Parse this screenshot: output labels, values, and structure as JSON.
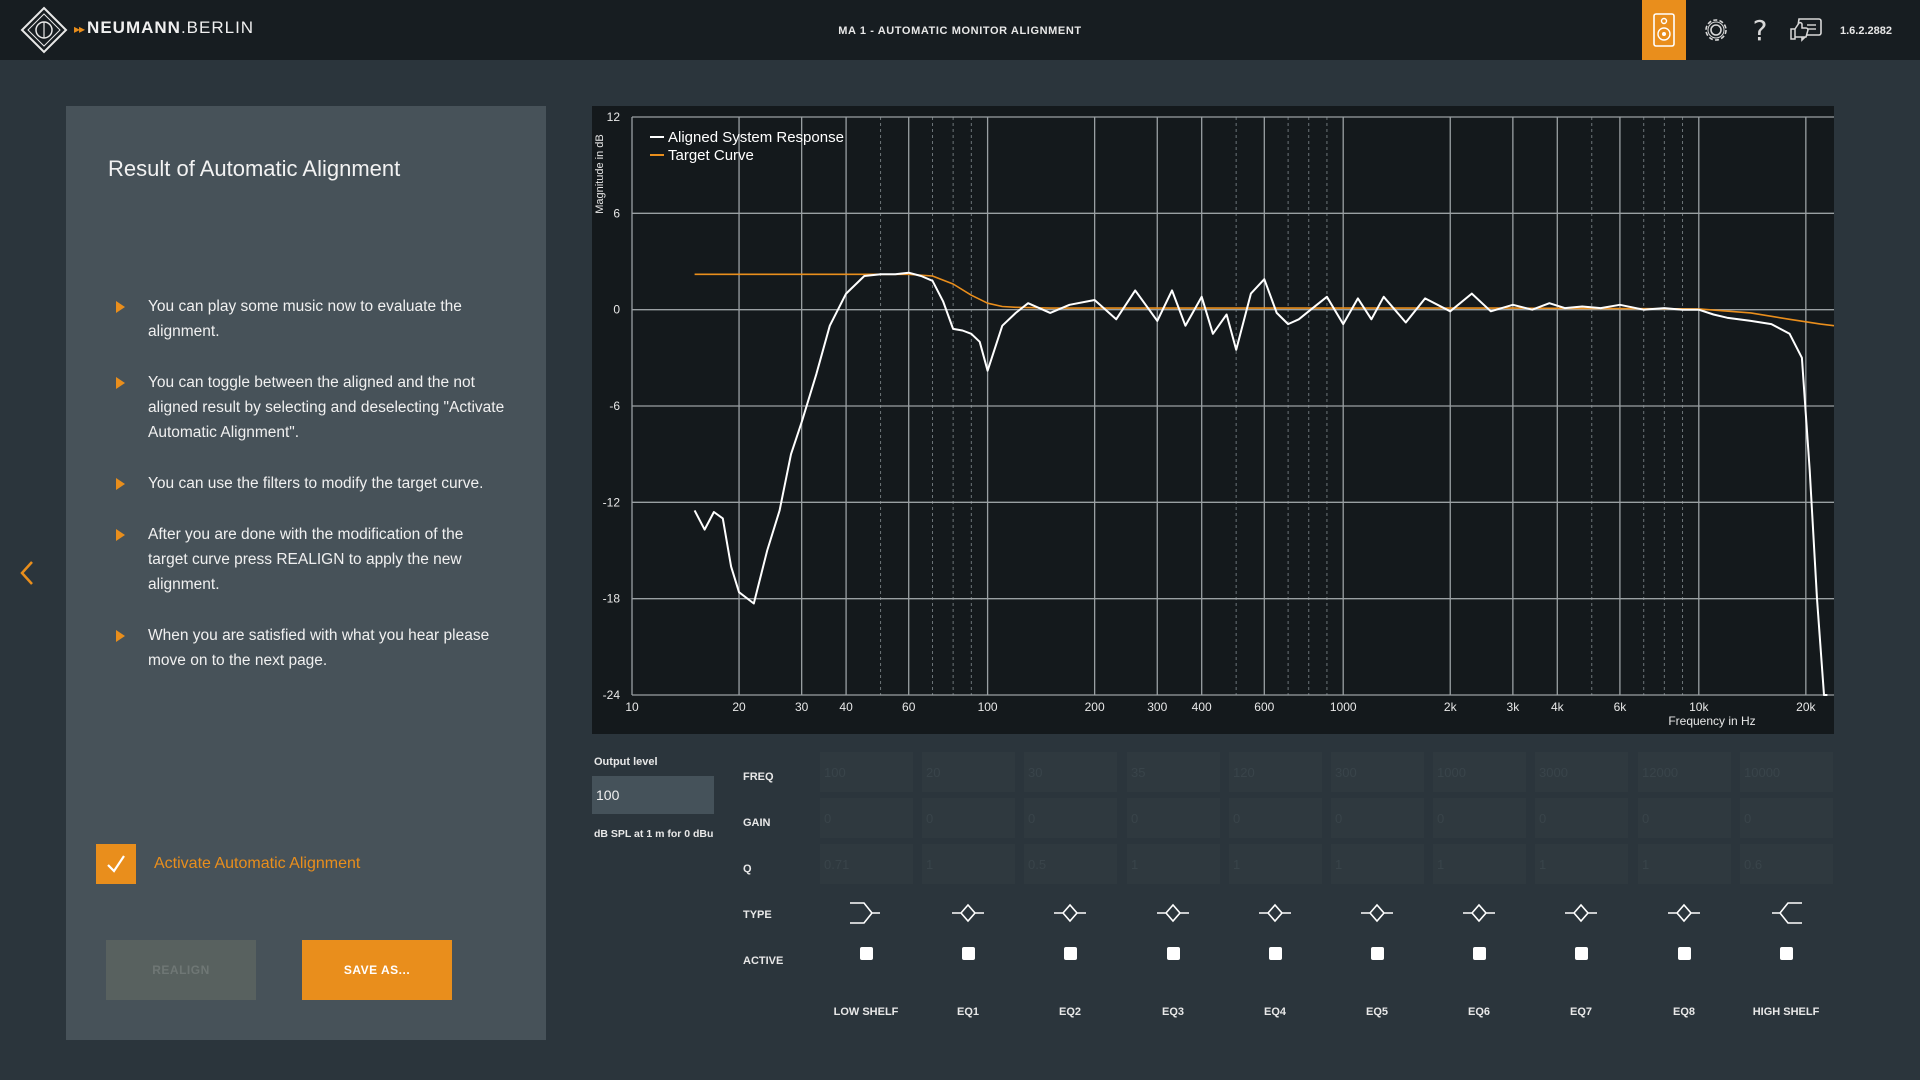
{
  "topbar": {
    "brand_main": "NEUMANN",
    "brand_sub": ".BERLIN",
    "title": "MA 1 - AUTOMATIC MONITOR ALIGNMENT",
    "version": "1.6.2.2882",
    "icons": [
      "speaker-icon",
      "gear-icon",
      "help-icon",
      "feedback-icon"
    ],
    "accent_color": "#e98e1c"
  },
  "left_panel": {
    "title": "Result of Automatic Alignment",
    "tips": [
      "You can play some music now to evaluate the alignment.",
      "You can toggle between the aligned and the not aligned result by selecting and deselecting \"Activate Automatic Alignment\".",
      "You can use the filters to modify the target curve.",
      "After you are done with the modification of the target curve press REALIGN to apply the new alignment.",
      "When you are satisfied with what you hear please move on to the next page."
    ],
    "checkbox_label": "Activate Automatic Alignment",
    "checkbox_checked": true,
    "realign_label": "REALIGN",
    "save_label": "SAVE AS..."
  },
  "chart_data": {
    "type": "line",
    "xlabel": "Frequency in Hz",
    "ylabel": "Magnitude in dB",
    "x_scale": "log",
    "xlim": [
      10,
      24000
    ],
    "ylim": [
      -24,
      12
    ],
    "y_ticks": [
      12,
      6,
      0,
      -6,
      -12,
      -18,
      -24
    ],
    "x_ticks": [
      10,
      20,
      30,
      40,
      60,
      100,
      200,
      300,
      400,
      600,
      1000,
      2000,
      3000,
      4000,
      6000,
      10000,
      20000
    ],
    "x_tick_labels": [
      "10",
      "20",
      "30",
      "40",
      "60",
      "100",
      "200",
      "300",
      "400",
      "600",
      "1000",
      "2k",
      "3k",
      "4k",
      "6k",
      "10k",
      "20k"
    ],
    "grid": true,
    "legend_position": "top-left",
    "series": [
      {
        "name": "Aligned System Response",
        "color": "#ffffff",
        "x": [
          15,
          16,
          17,
          18,
          19,
          20,
          22,
          24,
          26,
          28,
          30,
          33,
          36,
          40,
          45,
          50,
          55,
          60,
          65,
          70,
          75,
          80,
          85,
          90,
          95,
          100,
          110,
          120,
          130,
          150,
          170,
          200,
          230,
          260,
          300,
          330,
          360,
          400,
          430,
          470,
          500,
          550,
          600,
          650,
          700,
          750,
          800,
          900,
          1000,
          1100,
          1200,
          1300,
          1500,
          1700,
          2000,
          2300,
          2600,
          3000,
          3400,
          3800,
          4200,
          4700,
          5300,
          6000,
          7000,
          8000,
          9000,
          10000,
          11000,
          12000,
          14000,
          16000,
          18000,
          19500,
          20500,
          21500,
          22500,
          23000
        ],
        "y": [
          -12.5,
          -13.7,
          -12.6,
          -13.0,
          -16.0,
          -17.6,
          -18.3,
          -15.0,
          -12.5,
          -9.0,
          -7.0,
          -4.0,
          -1.0,
          1.0,
          2.1,
          2.2,
          2.2,
          2.3,
          2.1,
          1.8,
          0.5,
          -1.2,
          -1.3,
          -1.5,
          -2.0,
          -3.8,
          -1.0,
          -0.2,
          0.4,
          -0.2,
          0.3,
          0.6,
          -0.6,
          1.2,
          -0.7,
          1.2,
          -1.0,
          0.8,
          -1.5,
          -0.3,
          -2.5,
          1.0,
          1.9,
          -0.2,
          -0.9,
          -0.6,
          -0.1,
          0.8,
          -0.9,
          0.7,
          -0.6,
          0.8,
          -0.8,
          0.7,
          -0.1,
          1.0,
          -0.1,
          0.3,
          0.0,
          0.4,
          0.1,
          0.2,
          0.1,
          0.3,
          0.0,
          0.1,
          0.0,
          0.0,
          -0.3,
          -0.5,
          -0.7,
          -0.9,
          -1.5,
          -3.0,
          -10.0,
          -18.0,
          -24.0,
          -24.0
        ]
      },
      {
        "name": "Target Curve",
        "color": "#e98e1c",
        "x": [
          15,
          60,
          70,
          80,
          90,
          100,
          110,
          120,
          150,
          200,
          500,
          1000,
          3000,
          10000,
          14000,
          18000,
          22000,
          24000
        ],
        "y": [
          2.2,
          2.2,
          2.1,
          1.6,
          0.9,
          0.4,
          0.2,
          0.15,
          0.1,
          0.1,
          0.1,
          0.1,
          0.1,
          0.05,
          -0.2,
          -0.6,
          -0.9,
          -1.0
        ]
      }
    ]
  },
  "output": {
    "label": "Output level",
    "value": "100",
    "unit": "dB SPL at 1 m for 0 dBu"
  },
  "filter_table": {
    "row_labels": {
      "freq": "FREQ",
      "gain": "GAIN",
      "q": "Q",
      "type": "TYPE",
      "active": "ACTIVE"
    },
    "bands": [
      {
        "name": "LOW SHELF",
        "freq": "100",
        "gain": "0",
        "q": "0.71",
        "type": "low-shelf-icon"
      },
      {
        "name": "EQ1",
        "freq": "20",
        "gain": "0",
        "q": "1",
        "type": "peak-eq-icon"
      },
      {
        "name": "EQ2",
        "freq": "30",
        "gain": "0",
        "q": "0.5",
        "type": "peak-eq-icon"
      },
      {
        "name": "EQ3",
        "freq": "35",
        "gain": "0",
        "q": "1",
        "type": "peak-eq-icon"
      },
      {
        "name": "EQ4",
        "freq": "120",
        "gain": "0",
        "q": "1",
        "type": "peak-eq-icon"
      },
      {
        "name": "EQ5",
        "freq": "300",
        "gain": "0",
        "q": "1",
        "type": "peak-eq-icon"
      },
      {
        "name": "EQ6",
        "freq": "1000",
        "gain": "0",
        "q": "1",
        "type": "peak-eq-icon"
      },
      {
        "name": "EQ7",
        "freq": "3000",
        "gain": "0",
        "q": "1",
        "type": "peak-eq-icon"
      },
      {
        "name": "EQ8",
        "freq": "12000",
        "gain": "0",
        "q": "1",
        "type": "peak-eq-icon"
      },
      {
        "name": "HIGH SHELF",
        "freq": "10000",
        "gain": "0",
        "q": "0.6",
        "type": "high-shelf-icon"
      }
    ]
  }
}
